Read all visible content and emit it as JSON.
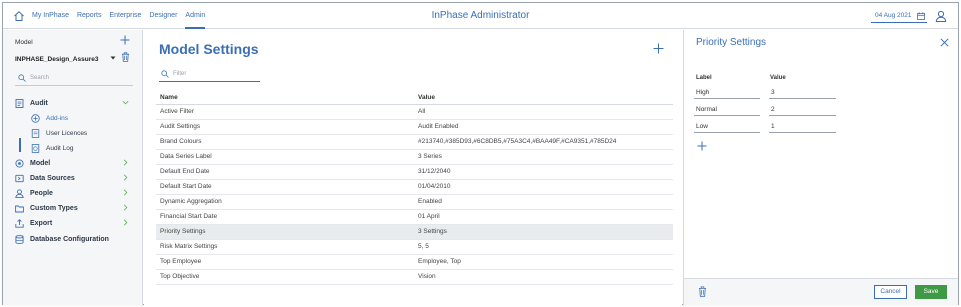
{
  "topbar": {
    "title": "InPhase Administrator",
    "nav": [
      "My InPhase",
      "Reports",
      "Enterprise",
      "Designer",
      "Admin"
    ],
    "active_nav": "Admin",
    "date": "04 Aug 2021",
    "accent_color": "#3a6fb6"
  },
  "sidebar": {
    "model_label": "Model",
    "model_name": "INPHASE_Design_Assure3",
    "search_placeholder": "Search",
    "audit": {
      "label": "Audit",
      "children": [
        {
          "label": "Add-ins",
          "icon": "plus-circle-icon",
          "active": true
        },
        {
          "label": "User Licences",
          "icon": "document-icon"
        },
        {
          "label": "Audit Log",
          "icon": "log-icon"
        }
      ]
    },
    "items": [
      {
        "label": "Model",
        "icon": "model-icon"
      },
      {
        "label": "Data Sources",
        "icon": "database-icon"
      },
      {
        "label": "People",
        "icon": "person-icon"
      },
      {
        "label": "Custom Types",
        "icon": "folder-icon"
      },
      {
        "label": "Export",
        "icon": "export-icon"
      },
      {
        "label": "Database Configuration",
        "icon": "database-config-icon"
      }
    ]
  },
  "main": {
    "title": "Model Settings",
    "filter_placeholder": "Filter",
    "columns": [
      "Name",
      "Value"
    ],
    "rows": [
      [
        "Active Filter",
        "All"
      ],
      [
        "Audit Settings",
        "Audit Enabled"
      ],
      [
        "Brand Colours",
        "#213740,#385D93,#6C8DB5,#75A3C4,#BAA49F,#CA9351,#785D24"
      ],
      [
        "Data Series Label",
        "3 Series"
      ],
      [
        "Default End Date",
        "31/12/2040"
      ],
      [
        "Default Start Date",
        "01/04/2010"
      ],
      [
        "Dynamic Aggregation",
        "Enabled"
      ],
      [
        "Financial Start Date",
        "01 April"
      ],
      [
        "Priority Settings",
        "3 Settings"
      ],
      [
        "Risk Matrix Settings",
        "5, 5"
      ],
      [
        "Top Employee",
        "Employee, Top"
      ],
      [
        "Top Objective",
        "Vision"
      ]
    ],
    "selected_row": 8
  },
  "panel": {
    "title": "Priority Settings",
    "columns": [
      "Label",
      "Value"
    ],
    "rows": [
      [
        "High",
        "3"
      ],
      [
        "Normal",
        "2"
      ],
      [
        "Low",
        "1"
      ]
    ],
    "cancel_label": "Cancel",
    "save_label": "Save",
    "save_color": "#3f9a45"
  }
}
